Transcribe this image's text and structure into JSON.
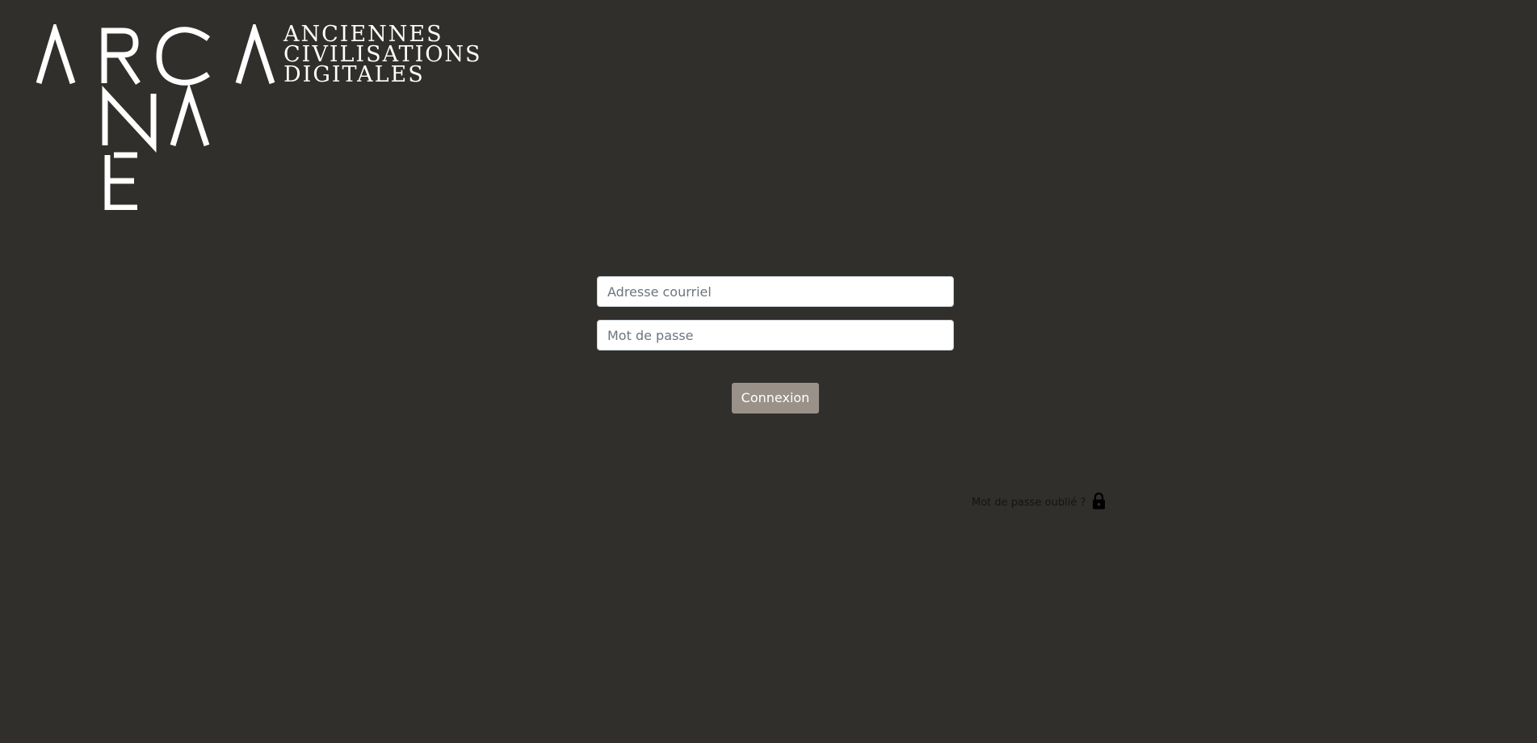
{
  "logo": {
    "wordmark": "ARCANAE",
    "tagline_lines": [
      "ANCIENNES",
      "CIVILISATIONS",
      "DIGITALES"
    ],
    "color": "#ffffff"
  },
  "login": {
    "email_placeholder": "Adresse courriel",
    "password_placeholder": "Mot de passe",
    "email_value": "",
    "password_value": "",
    "submit_label": "Connexion"
  },
  "forgot_password": {
    "label": "Mot de passe oublié ?",
    "icon": "lock-icon"
  },
  "colors": {
    "background": "#312f2b",
    "button": "#9a9189",
    "button_text": "#ffffff"
  }
}
